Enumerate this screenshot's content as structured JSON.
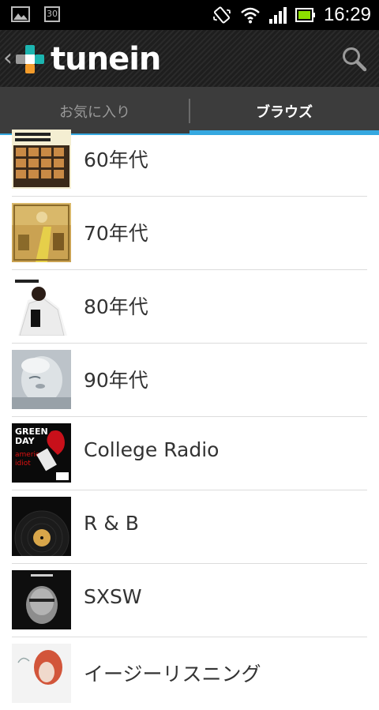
{
  "status_bar": {
    "time": "16:29",
    "calendar_day": "30",
    "icons": [
      "picture-icon",
      "calendar-icon",
      "vibrate-icon",
      "wifi-icon",
      "signal-icon",
      "battery-icon"
    ]
  },
  "app_bar": {
    "logo_text": "tunein",
    "back_glyph": "‹",
    "logo_colors": {
      "teal": "#1cb5b0",
      "orange": "#f39c2b",
      "grey": "#9a9a9a"
    }
  },
  "tabs": [
    {
      "label": "お気に入り",
      "active": false
    },
    {
      "label": "ブラウズ",
      "active": true
    }
  ],
  "accent_color": "#35a8e0",
  "items": [
    {
      "label": "60年代",
      "art": "beatles-second-album-art"
    },
    {
      "label": "70年代",
      "art": "yellow-brick-road-art"
    },
    {
      "label": "80年代",
      "art": "thriller-art"
    },
    {
      "label": "90年代",
      "art": "true-blue-art"
    },
    {
      "label": "College Radio",
      "art": "american-idiot-art",
      "art_text": [
        "GREEN",
        "DAY",
        "american",
        "idiot"
      ]
    },
    {
      "label": "R & B",
      "art": "vinyl-record-art"
    },
    {
      "label": "SXSW",
      "art": "sxsw-album-art"
    },
    {
      "label": "イージーリスニング",
      "art": "easy-listening-art"
    }
  ]
}
